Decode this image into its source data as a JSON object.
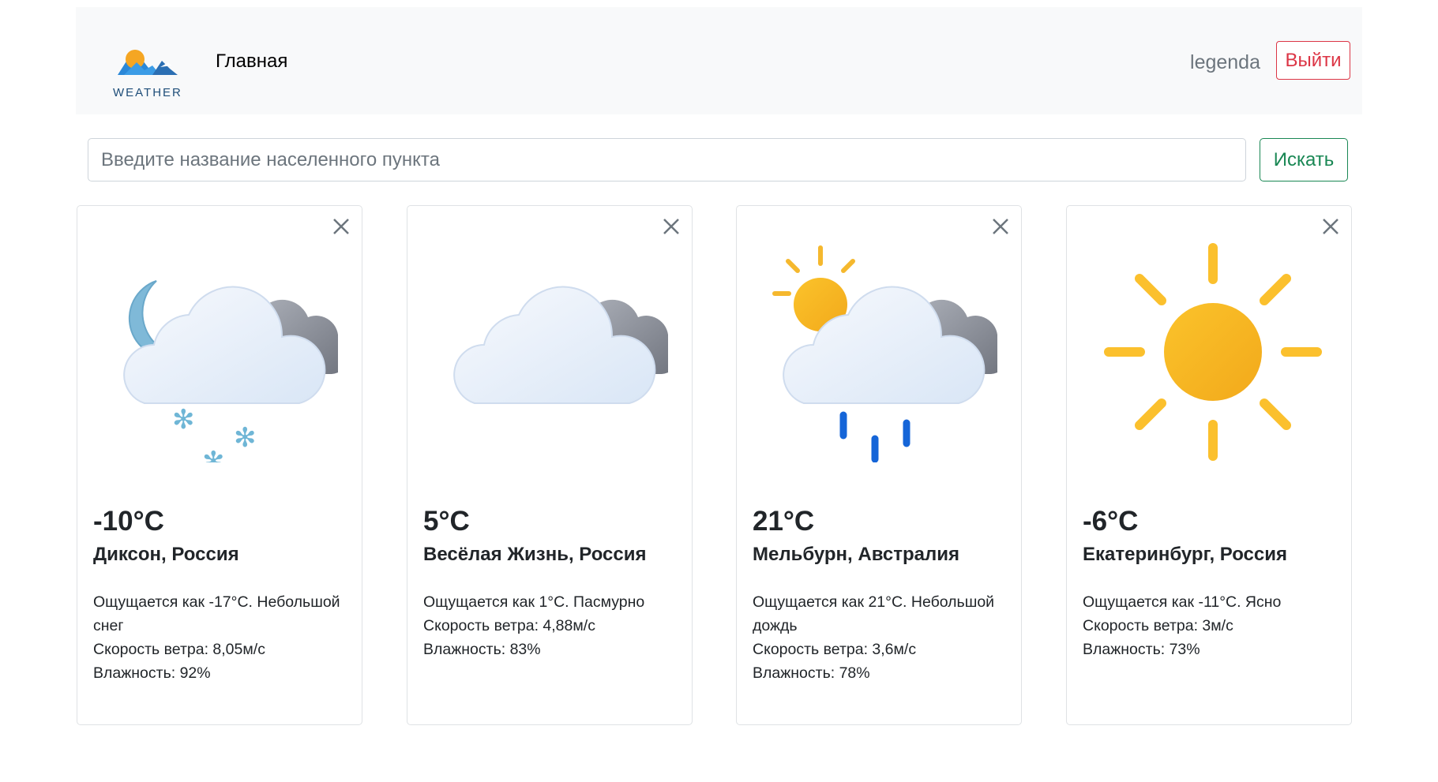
{
  "navbar": {
    "logo_text": "WEATHER",
    "home_label": "Главная",
    "username": "legenda",
    "logout_label": "Выйти"
  },
  "search": {
    "placeholder": "Введите название населенного пункта",
    "button_label": "Искать"
  },
  "colors": {
    "danger": "#dc3545",
    "success": "#198754",
    "navbar_bg": "#f8f9fa"
  },
  "cards": [
    {
      "icon": "night-cloud-snow-icon",
      "temp": "-10°C",
      "city": "Диксон, Россия",
      "feels": "Ощущается как -17°C. Небольшой снег",
      "wind": "Скорость ветра: 8,05м/с",
      "humidity": "Влажность: 92%"
    },
    {
      "icon": "cloudy-icon",
      "temp": "5°C",
      "city": "Весёлая Жизнь, Россия",
      "feels": "Ощущается как 1°C. Пасмурно",
      "wind": "Скорость ветра: 4,88м/с",
      "humidity": "Влажность: 83%"
    },
    {
      "icon": "sun-cloud-rain-icon",
      "temp": "21°C",
      "city": "Мельбурн, Австралия",
      "feels": "Ощущается как 21°C. Небольшой дождь",
      "wind": "Скорость ветра: 3,6м/с",
      "humidity": "Влажность: 78%"
    },
    {
      "icon": "sun-icon",
      "temp": "-6°C",
      "city": "Екатеринбург, Россия",
      "feels": "Ощущается как -11°C. Ясно",
      "wind": "Скорость ветра: 3м/с",
      "humidity": "Влажность: 73%"
    }
  ]
}
